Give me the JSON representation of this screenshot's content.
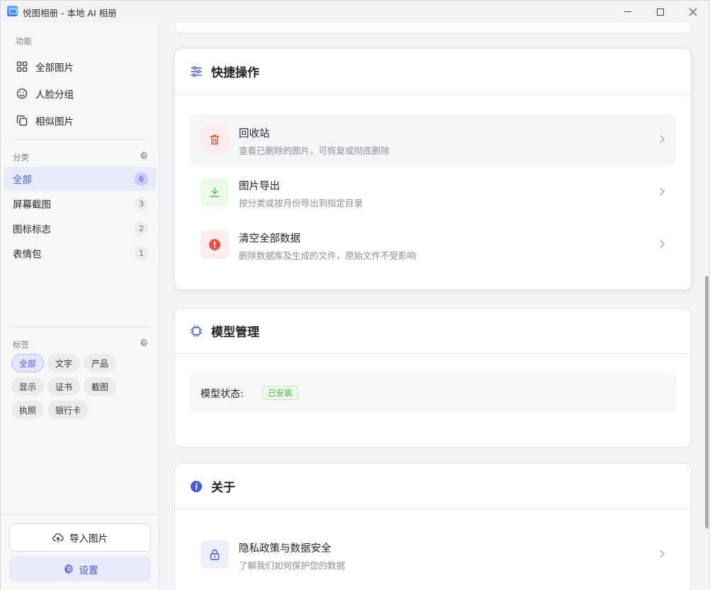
{
  "window": {
    "title": "悦图相册 - 本地 AI 相册"
  },
  "sidebar": {
    "functions_label": "功能",
    "functions": [
      {
        "label": "全部图片",
        "icon": "grid-icon"
      },
      {
        "label": "人脸分组",
        "icon": "smile-icon"
      },
      {
        "label": "相似图片",
        "icon": "copy-icon"
      }
    ],
    "categories_label": "分类",
    "categories": [
      {
        "label": "全部",
        "count": "6",
        "active": true
      },
      {
        "label": "屏幕截图",
        "count": "3"
      },
      {
        "label": "图标标志",
        "count": "2"
      },
      {
        "label": "表情包",
        "count": "1"
      }
    ],
    "tags_label": "标签",
    "tags": [
      {
        "label": "全部",
        "active": true
      },
      {
        "label": "文字"
      },
      {
        "label": "产品"
      },
      {
        "label": "显示"
      },
      {
        "label": "证书"
      },
      {
        "label": "截图"
      },
      {
        "label": "执照"
      },
      {
        "label": "银行卡"
      }
    ],
    "import_label": "导入图片",
    "settings_label": "设置"
  },
  "main": {
    "quick_actions": {
      "title": "快捷操作",
      "items": [
        {
          "title": "回收站",
          "subtitle": "查看已删除的图片，可恢复或彻底删除",
          "icon": "trash-icon"
        },
        {
          "title": "图片导出",
          "subtitle": "按分类或按月份导出到指定目录",
          "icon": "download-icon"
        },
        {
          "title": "清空全部数据",
          "subtitle": "删除数据库及生成的文件，原始文件不受影响",
          "icon": "alert-icon"
        }
      ]
    },
    "model": {
      "title": "模型管理",
      "status_label": "模型状态:",
      "status_value": "已安装"
    },
    "about": {
      "title": "关于",
      "items": [
        {
          "title": "隐私政策与数据安全",
          "subtitle": "了解我们如何保护您的数据",
          "icon": "lock-icon"
        }
      ]
    }
  },
  "colors": {
    "accent": "#4a56d8",
    "danger": "#e5534b",
    "success": "#4caf50"
  }
}
